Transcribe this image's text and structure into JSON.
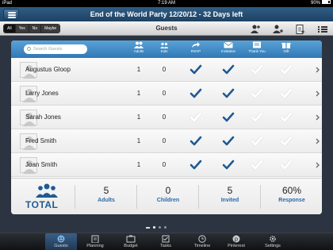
{
  "status": {
    "carrier": "iPad",
    "time": "7:19 AM",
    "battery": "90%"
  },
  "header": {
    "title": "End of the World Party   12/20/12 - 32 Days left"
  },
  "toolbar": {
    "filters": [
      "All",
      "Yes",
      "No",
      "Maybe"
    ],
    "active_filter": "All",
    "title": "Guests"
  },
  "search": {
    "placeholder": "Search Guests"
  },
  "columns": {
    "adults": "Adults",
    "kids": "Kids",
    "rsvp": "RSVP",
    "invitation": "Invitation",
    "thank_you": "Thank You",
    "gift": "Gift"
  },
  "guests": [
    {
      "name": "Augustus Gloop",
      "adults": "1",
      "kids": "0",
      "rsvp": true,
      "invitation": true,
      "thank_you": false,
      "gift": false
    },
    {
      "name": "Larry Jones",
      "adults": "1",
      "kids": "0",
      "rsvp": true,
      "invitation": true,
      "thank_you": false,
      "gift": false
    },
    {
      "name": "Sarah Jones",
      "adults": "1",
      "kids": "0",
      "rsvp": false,
      "invitation": true,
      "thank_you": false,
      "gift": false
    },
    {
      "name": "Fred Smith",
      "adults": "1",
      "kids": "0",
      "rsvp": true,
      "invitation": true,
      "thank_you": false,
      "gift": false
    },
    {
      "name": "Joan Smith",
      "adults": "1",
      "kids": "0",
      "rsvp": true,
      "invitation": true,
      "thank_you": false,
      "gift": false
    }
  ],
  "totals": {
    "label": "TOTAL",
    "adults": {
      "value": "5",
      "label": "Adults"
    },
    "children": {
      "value": "0",
      "label": "Children"
    },
    "invited": {
      "value": "5",
      "label": "Invited"
    },
    "response": {
      "value": "60%",
      "label": "Response"
    }
  },
  "tabs": [
    {
      "label": "Guests",
      "icon": "guests-icon",
      "active": true
    },
    {
      "label": "Planning",
      "icon": "planning-icon",
      "active": false
    },
    {
      "label": "Budget",
      "icon": "budget-icon",
      "active": false
    },
    {
      "label": "Tasks",
      "icon": "tasks-icon",
      "active": false
    },
    {
      "label": "Timeline",
      "icon": "timeline-icon",
      "active": false
    },
    {
      "label": "Pinterest",
      "icon": "pinterest-icon",
      "active": false
    },
    {
      "label": "Settings",
      "icon": "settings-icon",
      "active": false
    }
  ],
  "colors": {
    "accent": "#2f78b5",
    "check_on": "#1f5a93",
    "check_off": "#ffffff"
  }
}
